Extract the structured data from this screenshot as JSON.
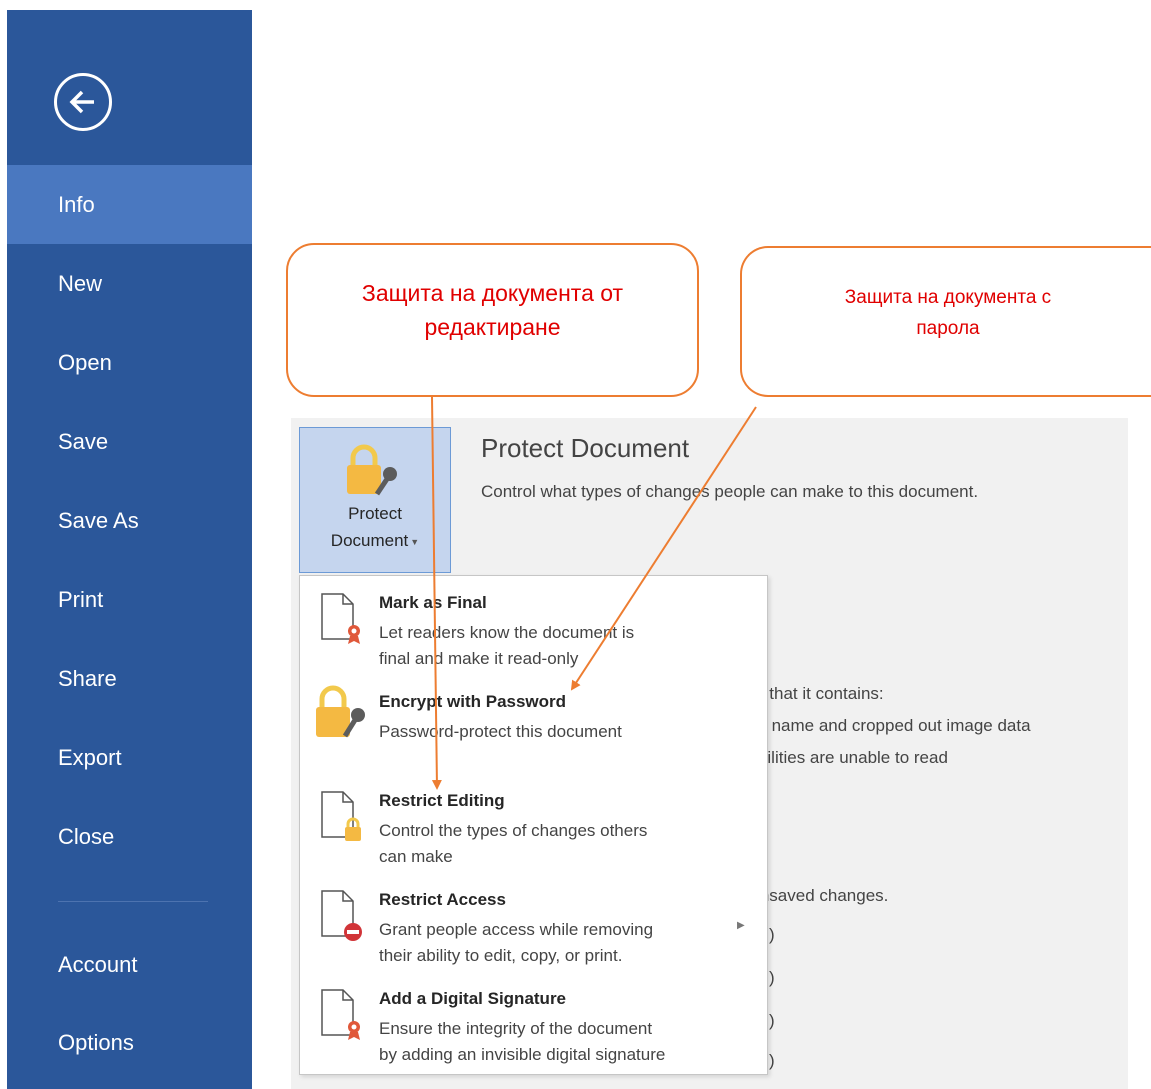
{
  "sidebar": {
    "back_icon": "arrow-left-circle-icon",
    "items": [
      {
        "label": "Info",
        "active": true
      },
      {
        "label": "New"
      },
      {
        "label": "Open"
      },
      {
        "label": "Save"
      },
      {
        "label": "Save As"
      },
      {
        "label": "Print"
      },
      {
        "label": "Share"
      },
      {
        "label": "Export"
      },
      {
        "label": "Close"
      }
    ],
    "bottom_items": [
      {
        "label": "Account"
      },
      {
        "label": "Options"
      }
    ]
  },
  "protect": {
    "button_line1": "Protect",
    "button_line2": "Document",
    "title": "Protect Document",
    "description": "Control what types of changes people can make to this document."
  },
  "background_text": {
    "line1": "are that it contains:",
    "line2": "or's name and cropped out image data",
    "line3": "sabilities are unable to read",
    "line4": "r unsaved changes.",
    "paren1": ")",
    "paren2": ")",
    "paren3": ")",
    "paren4": ")"
  },
  "menu": {
    "items": [
      {
        "title": "Mark as Final",
        "desc1": "Let readers know the document is",
        "desc2": "final and make it read-only",
        "icon": "mark-final-icon"
      },
      {
        "title": "Encrypt with Password",
        "desc1": "Password-protect this document",
        "icon": "lock-key-icon"
      },
      {
        "title": "Restrict Editing",
        "desc1": "Control the types of changes others",
        "desc2": "can make",
        "icon": "restrict-editing-icon"
      },
      {
        "title": "Restrict Access",
        "desc1": "Grant people access while removing",
        "desc2": "their ability to edit, copy, or print.",
        "icon": "restrict-access-icon"
      },
      {
        "title": "Add a Digital Signature",
        "desc1": "Ensure the integrity of the document",
        "desc2": "by adding an invisible digital signature",
        "icon": "digital-signature-icon"
      }
    ]
  },
  "callouts": {
    "left_line1": "Защита на документа от",
    "left_line2": "редактиране",
    "right_line1": "Защита на документа с",
    "right_line2": "парола"
  },
  "colors": {
    "sidebar": "#2b579a",
    "sidebar_active": "#4a78c0",
    "callout_border": "#ed7d31",
    "callout_text": "#e00000"
  }
}
